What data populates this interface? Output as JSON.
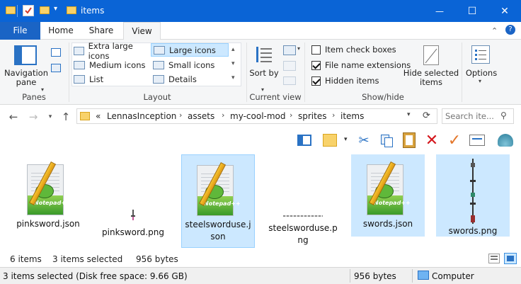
{
  "window": {
    "title": "items",
    "minimize_glyph": "—",
    "maximize_glyph": "☐",
    "close_glyph": "✕"
  },
  "ribbon_tabs": [
    {
      "label": "File"
    },
    {
      "label": "Home"
    },
    {
      "label": "Share"
    },
    {
      "label": "View"
    }
  ],
  "ribbon": {
    "panes": {
      "navigation_pane": "Navigation pane",
      "group_label": "Panes"
    },
    "layout": {
      "items": [
        "Extra large icons",
        "Large icons",
        "Medium icons",
        "Small icons",
        "List",
        "Details"
      ],
      "selected": "Large icons",
      "group_label": "Layout"
    },
    "current_view": {
      "sort_by": "Sort by",
      "group_label": "Current view"
    },
    "show_hide": {
      "item_check_boxes": "Item check boxes",
      "file_name_extensions": "File name extensions",
      "hidden_items": "Hidden items",
      "hide_selected_items": "Hide selected items",
      "group_label": "Show/hide"
    },
    "options": "Options"
  },
  "address": {
    "prefix": "«",
    "crumbs": [
      "LennasInception",
      "assets",
      "my-cool-mod",
      "sprites",
      "items"
    ],
    "search_placeholder": "Search ite..."
  },
  "files": [
    {
      "name": "pinksword.json",
      "type": "notepad",
      "selected": false
    },
    {
      "name": "pinksword.png",
      "type": "sword-small",
      "selected": false
    },
    {
      "name": "steelsworduse.json",
      "type": "notepad",
      "selected": true
    },
    {
      "name": "steelsworduse.png",
      "type": "sword-flat",
      "selected": false
    },
    {
      "name": "swords.json",
      "type": "notepad",
      "selected": true
    },
    {
      "name": "swords.png",
      "type": "sword-tall",
      "selected": true
    }
  ],
  "info": {
    "item_count": "6 items",
    "selection": "3 items selected",
    "size": "956 bytes"
  },
  "status": {
    "left": "3 items selected (Disk free space: 9.66 GB)",
    "size": "956 bytes",
    "location": "Computer"
  },
  "colors": {
    "titlebar": "#0a64d6",
    "file_tab": "#1a64c5",
    "selection": "#cce8ff",
    "selection_border": "#99d1ff"
  }
}
